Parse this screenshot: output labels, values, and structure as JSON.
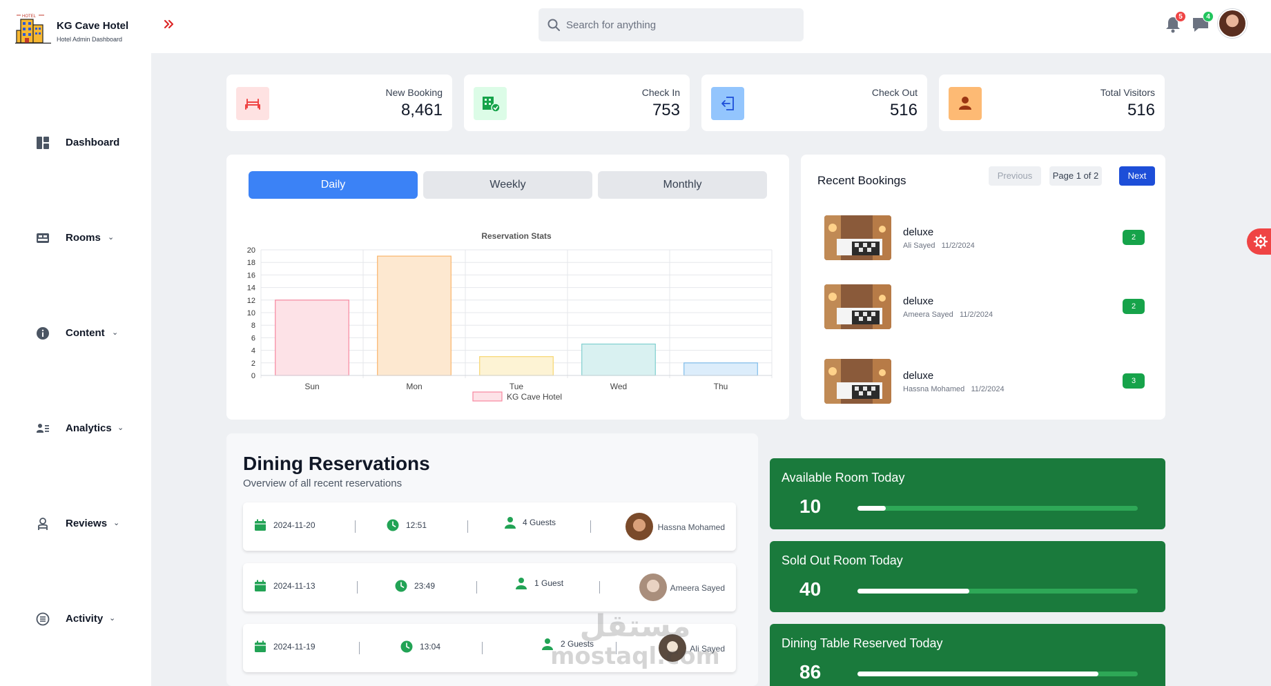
{
  "brand": {
    "title": "KG Cave Hotel",
    "subtitle": "Hotel Admin Dashboard",
    "logo_text": "HOTEL"
  },
  "search": {
    "placeholder": "Search for anything"
  },
  "header": {
    "notifications_count": "5",
    "messages_count": "4"
  },
  "sidebar": {
    "items": [
      {
        "label": "Dashboard",
        "icon": "dashboard-icon",
        "has_chevron": false
      },
      {
        "label": "Rooms",
        "icon": "bed-icon",
        "has_chevron": true
      },
      {
        "label": "Content",
        "icon": "info-icon",
        "has_chevron": true
      },
      {
        "label": "Analytics",
        "icon": "analytics-icon",
        "has_chevron": true
      },
      {
        "label": "Reviews",
        "icon": "reviews-icon",
        "has_chevron": true
      },
      {
        "label": "Activity",
        "icon": "activity-icon",
        "has_chevron": true
      }
    ]
  },
  "stats": [
    {
      "label": "New Booking",
      "value": "8,461",
      "icon": "bed-icon",
      "color": "#fee2e2"
    },
    {
      "label": "Check In",
      "value": "753",
      "icon": "hotel-check-icon",
      "color": "#dcfce7"
    },
    {
      "label": "Check Out",
      "value": "516",
      "icon": "exit-icon",
      "color": "#93c5fd"
    },
    {
      "label": "Total Visitors",
      "value": "516",
      "icon": "user-icon",
      "color": "#fdba74"
    }
  ],
  "chart_tabs": {
    "daily": "Daily",
    "weekly": "Weekly",
    "monthly": "Monthly"
  },
  "chart_data": {
    "type": "bar",
    "title": "Reservation Stats",
    "categories": [
      "Sun",
      "Mon",
      "Tue",
      "Wed",
      "Thu"
    ],
    "series": [
      {
        "name": "KG Cave Hotel",
        "values": [
          12,
          19,
          3,
          5,
          2
        ]
      }
    ],
    "bar_colors": [
      "#fde2e7",
      "#fde8d0",
      "#fdf3d4",
      "#d9f1f1",
      "#dcedfb"
    ],
    "bar_borders": [
      "#f7879f",
      "#f9b46a",
      "#f7d66e",
      "#7fcfcf",
      "#7fbce9"
    ],
    "ylim": [
      0,
      20
    ],
    "yticks": [
      0,
      2,
      4,
      6,
      8,
      10,
      12,
      14,
      16,
      18,
      20
    ],
    "grid": true,
    "legend_position": "bottom"
  },
  "bookings": {
    "title": "Recent Bookings",
    "prev": "Previous",
    "page_info": "Page 1 of 2",
    "next": "Next",
    "items": [
      {
        "room": "deluxe",
        "guest": "Ali Sayed",
        "date": "11/2/2024",
        "count": "2"
      },
      {
        "room": "deluxe",
        "guest": "Ameera Sayed",
        "date": "11/2/2024",
        "count": "2"
      },
      {
        "room": "deluxe",
        "guest": "Hassna Mohamed",
        "date": "11/2/2024",
        "count": "3"
      }
    ]
  },
  "dining": {
    "title": "Dining Reservations",
    "subtitle": "Overview of all recent reservations",
    "rows": [
      {
        "date": "2024-11-20",
        "time": "12:51",
        "guests": "4 Guests",
        "name": "Hassna Mohamed"
      },
      {
        "date": "2024-11-13",
        "time": "23:49",
        "guests": "1 Guest",
        "name": "Ameera Sayed"
      },
      {
        "date": "2024-11-19",
        "time": "13:04",
        "guests": "2 Guests",
        "name": "Ali Sayed"
      }
    ]
  },
  "summary": [
    {
      "title": "Available Room Today",
      "value": "10",
      "progress": 0.1
    },
    {
      "title": "Sold Out Room Today",
      "value": "40",
      "progress": 0.4
    },
    {
      "title": "Dining Table Reserved Today",
      "value": "86",
      "progress": 0.86
    }
  ],
  "colors": {
    "accent": "#3b82f6",
    "green": "#1a7a3c",
    "red": "#ef4444",
    "primary_dark": "#1d4ed8"
  },
  "watermark": {
    "arabic": "مستقل",
    "latin": "mostaql.com"
  }
}
